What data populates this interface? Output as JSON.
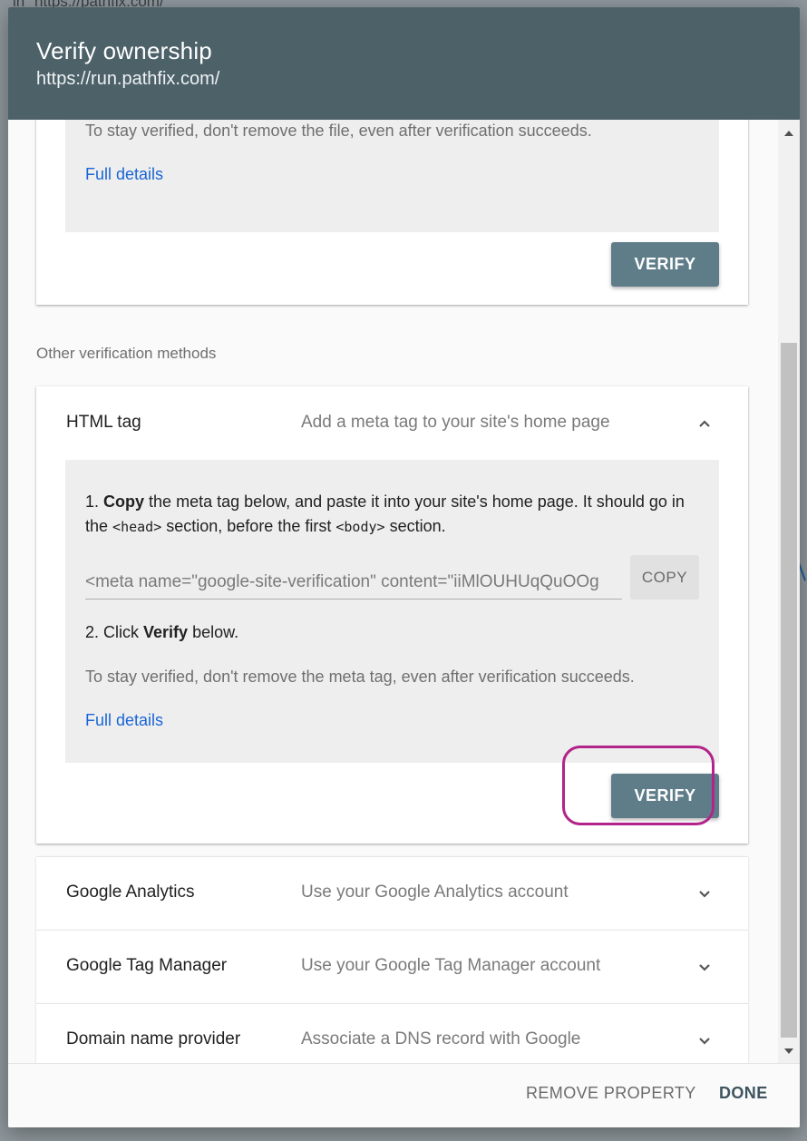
{
  "backdrop": {
    "url_fragment": "in \"https://pathfix.com/\""
  },
  "dialog": {
    "title": "Verify ownership",
    "subtitle": "https://run.pathfix.com/"
  },
  "html_file_method": {
    "stay_verified": "To stay verified, don't remove the file, even after verification succeeds.",
    "full_details": "Full details",
    "verify_label": "VERIFY"
  },
  "other_methods_label": "Other verification methods",
  "html_tag": {
    "title": "HTML tag",
    "description": "Add a meta tag to your site's home page",
    "step1_prefix": "1.",
    "step1_bold": "Copy",
    "step1_text_a": "the meta tag below, and paste it into your site's home page. It should go in the",
    "step1_code_head": "<head>",
    "step1_text_b": "section, before the first",
    "step1_code_body": "<body>",
    "step1_text_c": "section.",
    "meta_value": "<meta name=\"google-site-verification\" content=\"iiMlOUHUqQuOOg",
    "copy_label": "COPY",
    "step2_prefix": "2. Click",
    "step2_bold": "Verify",
    "step2_suffix": "below.",
    "stay_verified": "To stay verified, don't remove the meta tag, even after verification succeeds.",
    "full_details": "Full details",
    "verify_label": "VERIFY"
  },
  "methods": [
    {
      "title": "Google Analytics",
      "description": "Use your Google Analytics account"
    },
    {
      "title": "Google Tag Manager",
      "description": "Use your Google Tag Manager account"
    },
    {
      "title": "Domain name provider",
      "description": "Associate a DNS record with Google"
    }
  ],
  "footer": {
    "remove_label": "REMOVE PROPERTY",
    "done_label": "DONE"
  },
  "colors": {
    "header_bg": "#4d6169",
    "verify_button": "#5f7d89",
    "link": "#1a66d6",
    "highlight": "#b2248a"
  },
  "icons": {
    "expand": "chevron-down-icon",
    "collapse": "chevron-up-icon"
  }
}
